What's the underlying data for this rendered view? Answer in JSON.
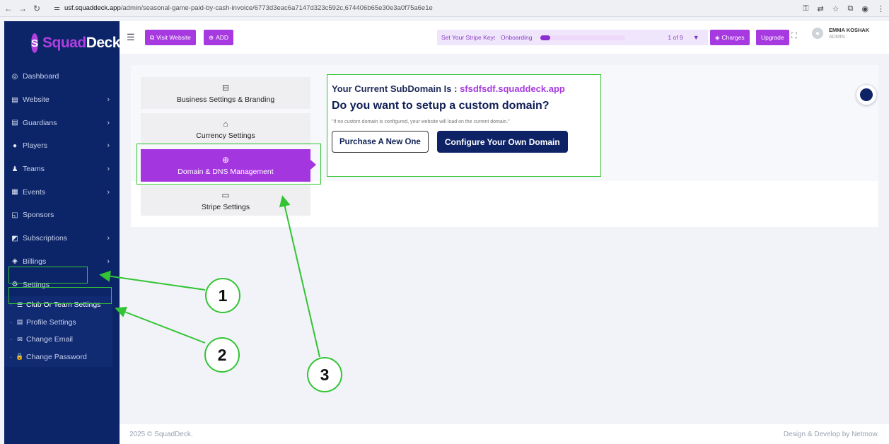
{
  "browser": {
    "url_host": "usf.squaddeck.app",
    "url_path": "/admin/seasonal-game-paid-by-cash-invoice/6773d3eac6a7147d323c592c,674406b65e30e3a0f75a6e1e"
  },
  "logo": {
    "mark": "S",
    "text_a": "Squad",
    "text_b": "Deck"
  },
  "sidebar": {
    "items": [
      {
        "label": "Dashboard",
        "icon": "dashboard-icon",
        "glyph": "◎",
        "chevron": ""
      },
      {
        "label": "Website",
        "icon": "website-icon",
        "glyph": "▤",
        "chevron": "›"
      },
      {
        "label": "Guardians",
        "icon": "guardians-icon",
        "glyph": "▤",
        "chevron": "›"
      },
      {
        "label": "Players",
        "icon": "players-icon",
        "glyph": "●",
        "chevron": "›"
      },
      {
        "label": "Teams",
        "icon": "teams-icon",
        "glyph": "♟",
        "chevron": "›"
      },
      {
        "label": "Events",
        "icon": "events-icon",
        "glyph": "▦",
        "chevron": "›"
      },
      {
        "label": "Sponsors",
        "icon": "sponsors-icon",
        "glyph": "◱",
        "chevron": ""
      },
      {
        "label": "Subscriptions",
        "icon": "subscriptions-icon",
        "glyph": "◩",
        "chevron": "›"
      },
      {
        "label": "Billings",
        "icon": "billings-icon",
        "glyph": "◈",
        "chevron": "›"
      },
      {
        "label": "Settings",
        "icon": "settings-icon",
        "glyph": "⚙",
        "chevron": ""
      }
    ],
    "sub_items": [
      {
        "label": "Club Or Team Settings",
        "glyph": "☰"
      },
      {
        "label": "Profile Settings",
        "glyph": "▤"
      },
      {
        "label": "Change Email",
        "glyph": "✉"
      },
      {
        "label": "Change Password",
        "glyph": "🔒"
      }
    ]
  },
  "header": {
    "visit_website": "Visit Website",
    "add": "ADD",
    "stripe_keys": "Set Your Stripe Keys",
    "onboarding": "Onboarding",
    "onboarding_count": "1 of 9",
    "onboarding_progress": 0.11,
    "charges": "Charges",
    "upgrade": "Upgrade",
    "user_name": "EMMA KOSHAK",
    "user_role": "ADMIN"
  },
  "tabs": [
    {
      "label": "Business Settings & Branding",
      "icon": "briefcase-icon",
      "glyph": "⊟"
    },
    {
      "label": "Currency Settings",
      "icon": "currency-icon",
      "glyph": "⌂"
    },
    {
      "label": "Domain & DNS Management",
      "icon": "globe-icon",
      "glyph": "⊕"
    },
    {
      "label": "Stripe Settings",
      "icon": "card-icon",
      "glyph": "▭"
    }
  ],
  "domain": {
    "subdomain_label": "Your Current SubDomain Is : ",
    "subdomain_value": "sfsdfsdf.squaddeck.app",
    "question": "Do you want to setup a custom domain?",
    "note": "\"If no custom domain is configured, your website will load on the current domain.\"",
    "purchase_button": "Purchase A New One",
    "configure_button": "Configure Your Own Domain"
  },
  "footer": {
    "copyright": "2025 © SquadDeck.",
    "credit": "Design & Develop by Netmow."
  },
  "annotations": {
    "one": "1",
    "two": "2",
    "three": "3"
  },
  "colors": {
    "accent": "#a63ae0",
    "sidebar": "#0c2568",
    "highlight": "#33c433",
    "primary_dark": "#0e2366"
  }
}
